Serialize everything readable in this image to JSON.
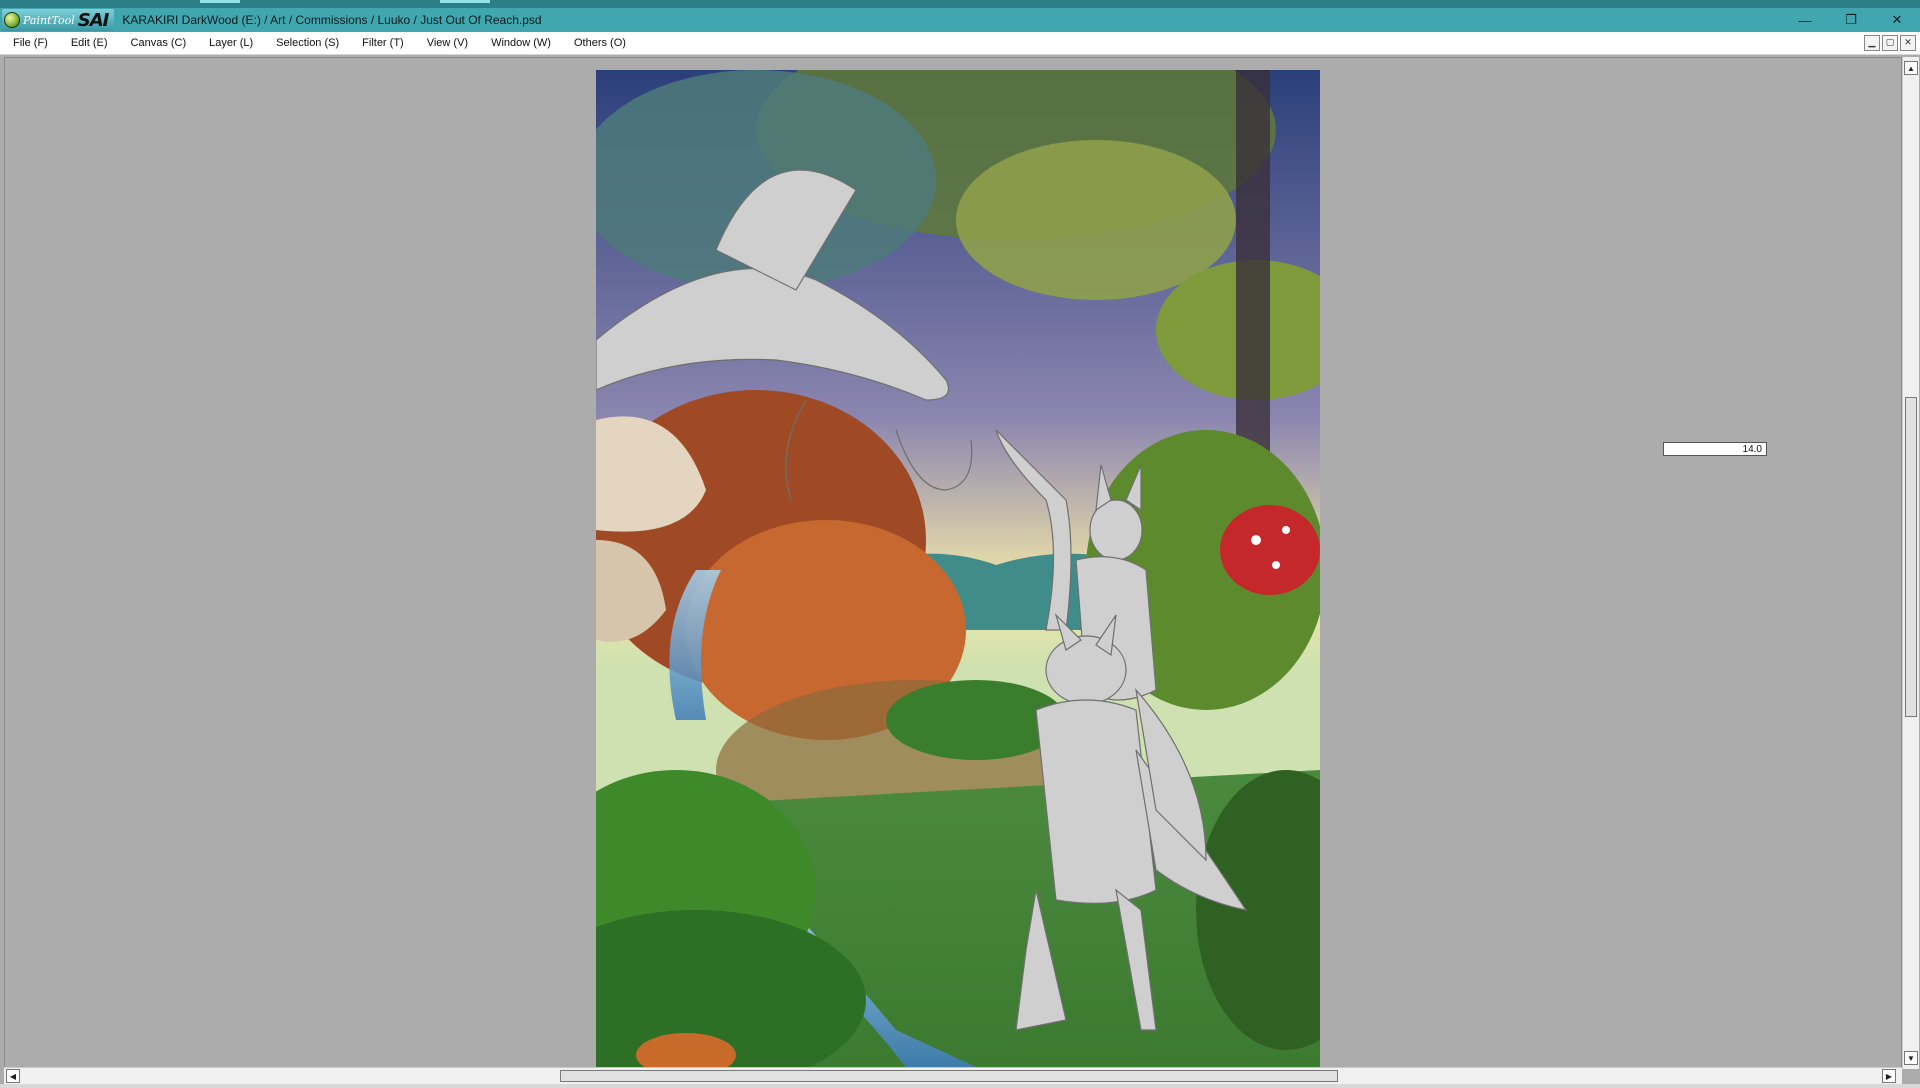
{
  "app": {
    "logo_paint": "PaintTool",
    "logo_sai": "SAI",
    "window_title": "KARAKIRI DarkWood (E:) / Art / Commissions / Luuko / Just Out Of Reach.psd"
  },
  "window_controls": {
    "minimize": "—",
    "restore": "❐",
    "close": "✕"
  },
  "menu": {
    "items": [
      {
        "label": "File (F)"
      },
      {
        "label": "Edit (E)"
      },
      {
        "label": "Canvas (C)"
      },
      {
        "label": "Layer (L)"
      },
      {
        "label": "Selection (S)"
      },
      {
        "label": "Filter (T)"
      },
      {
        "label": "View (V)"
      },
      {
        "label": "Window (W)"
      },
      {
        "label": "Others (O)"
      }
    ]
  },
  "mdi_controls": {
    "minimize": "▁",
    "restore": "▢",
    "close": "✕"
  },
  "canvas": {
    "brush_size_value": "14.0"
  },
  "scrollbars": {
    "up_arrow": "▲",
    "down_arrow": "▼",
    "left_arrow": "◀",
    "right_arrow": "▶"
  },
  "colors": {
    "titlebar": "#40a7b1",
    "workspace": "#acacac"
  }
}
